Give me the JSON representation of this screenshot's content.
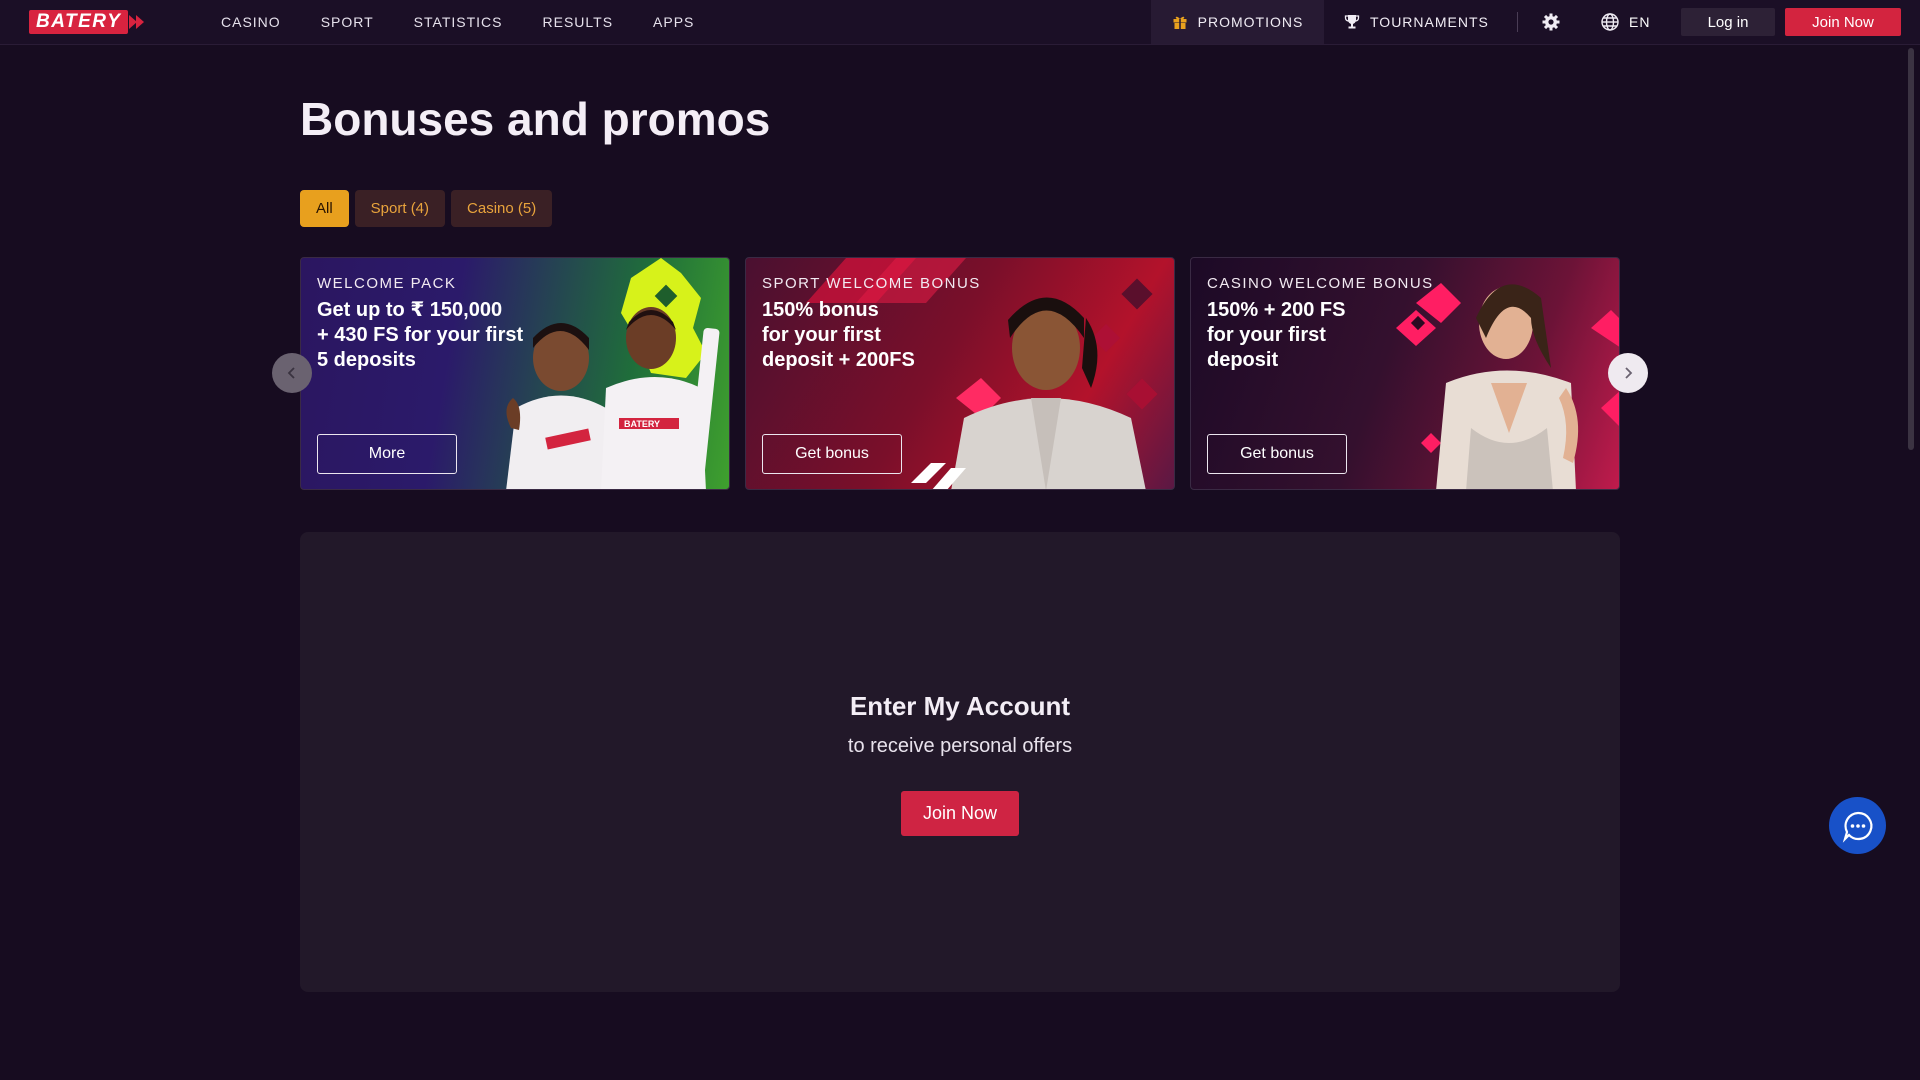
{
  "header": {
    "logo_text": "BATERY",
    "nav": [
      "CASINO",
      "SPORT",
      "STATISTICS",
      "RESULTS",
      "APPS"
    ],
    "promotions_label": "PROMOTIONS",
    "tournaments_label": "TOURNAMENTS",
    "language": "EN",
    "login_label": "Log in",
    "join_label": "Join Now"
  },
  "page": {
    "title": "Bonuses and promos",
    "filters": [
      {
        "label": "All",
        "active": true
      },
      {
        "label": "Sport (4)",
        "active": false
      },
      {
        "label": "Casino (5)",
        "active": false
      }
    ]
  },
  "cards": [
    {
      "eyebrow": "WELCOME PACK",
      "headline": "Get up to ₹ 150,000\n+ 430 FS for your first\n5 deposits",
      "cta": "More",
      "jersey_text": "BATERY"
    },
    {
      "eyebrow": "SPORT WELCOME BONUS",
      "headline": "150% bonus\nfor your first\ndeposit + 200FS",
      "cta": "Get bonus"
    },
    {
      "eyebrow": "CASINO WELCOME BONUS",
      "headline": "150% + 200 FS\nfor your first\ndeposit",
      "cta": "Get bonus"
    }
  ],
  "account": {
    "title": "Enter My Account",
    "subtitle": "to receive personal offers",
    "join_label": "Join Now"
  },
  "icons": {
    "promotions": "gift-icon",
    "tournaments": "trophy-icon",
    "settings": "gear-icon",
    "language": "globe-icon",
    "carousel_prev": "chevron-left-icon",
    "carousel_next": "chevron-right-icon",
    "chat": "chat-icon"
  },
  "colors": {
    "brand_red": "#d3243f",
    "accent_gold": "#e8a01e",
    "background": "#170c20",
    "chat_blue": "#1851c8"
  }
}
